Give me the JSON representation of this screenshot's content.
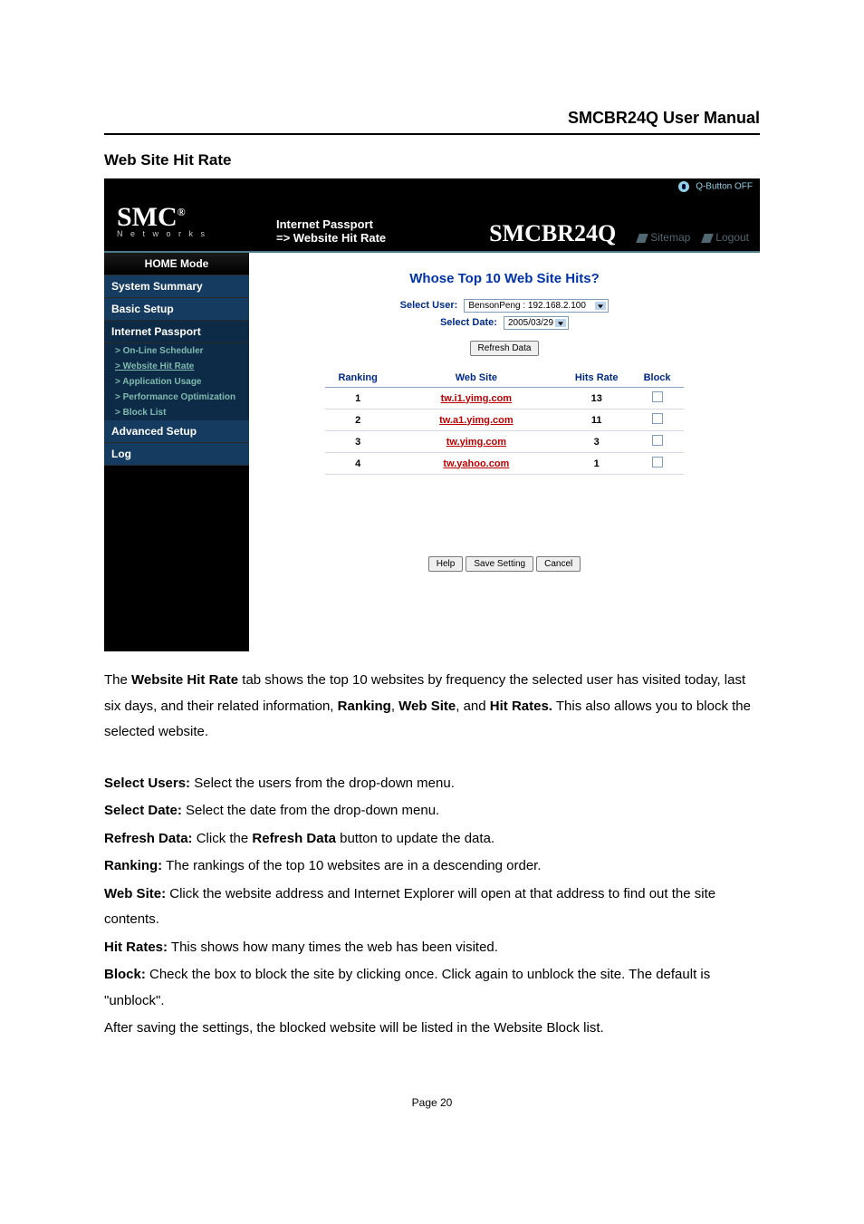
{
  "manual_title": "SMCBR24Q User Manual",
  "section_title": "Web Site Hit Rate",
  "router": {
    "qbutton_label": "Q-Button OFF",
    "logo": {
      "main": "SMC",
      "reg": "®",
      "sub": "N e t w o r k s"
    },
    "breadcrumb": {
      "line1": "Internet Passport",
      "line2": "=> Website Hit Rate"
    },
    "product": "SMCBR24Q",
    "header_links": {
      "sitemap": "Sitemap",
      "logout": "Logout"
    },
    "sidebar": {
      "home": "HOME Mode",
      "summary": "System Summary",
      "basic": "Basic Setup",
      "passport": "Internet Passport",
      "subs": {
        "scheduler": "> On-Line Scheduler",
        "hitrate": "> Website Hit Rate",
        "appusage": "> Application Usage",
        "perf": "> Performance Optimization",
        "block": "> Block List"
      },
      "advanced": "Advanced Setup",
      "log": "Log"
    },
    "content": {
      "title": "Whose Top 10 Web Site Hits?",
      "select_user_label": "Select User:",
      "select_user_value": "BensonPeng : 192.168.2.100",
      "select_date_label": "Select Date:",
      "select_date_value": "2005/03/29",
      "refresh_button": "Refresh Data",
      "table": {
        "headers": {
          "ranking": "Ranking",
          "website": "Web Site",
          "hitsrate": "Hits Rate",
          "block": "Block"
        },
        "rows": [
          {
            "rank": "1",
            "site": "tw.i1.yimg.com",
            "hits": "13"
          },
          {
            "rank": "2",
            "site": "tw.a1.yimg.com",
            "hits": "11"
          },
          {
            "rank": "3",
            "site": "tw.yimg.com",
            "hits": "3"
          },
          {
            "rank": "4",
            "site": "tw.yahoo.com",
            "hits": "1"
          }
        ]
      },
      "actions": {
        "help": "Help",
        "save": "Save Setting",
        "cancel": "Cancel"
      }
    }
  },
  "doc": {
    "p_intro_1": "The ",
    "p_intro_b1": "Website Hit Rate",
    "p_intro_2": " tab shows the top 10 websites by frequency the selected user has visited today, last six days, and their related information, ",
    "p_intro_b2": "Ranking",
    "p_intro_3": ", ",
    "p_intro_b3": "Web Site",
    "p_intro_4": ", and ",
    "p_intro_b4": "Hit Rates.",
    "p_intro_5": " This also allows you to block the selected website.",
    "select_users_b": "Select Users:",
    "select_users_t": " Select the users from the drop-down menu.",
    "select_date_b": "Select Date:",
    "select_date_t": " Select the date from the drop-down menu.",
    "refresh_b1": "Refresh Data:",
    "refresh_t1": " Click the ",
    "refresh_b2": "Refresh Data",
    "refresh_t2": " button to update the data.",
    "ranking_b": "Ranking:",
    "ranking_t": " The rankings of the top 10 websites are in a descending order.",
    "website_b": "Web Site:",
    "website_t": " Click the website address and Internet Explorer will open at that address to find out the site contents.",
    "hitrates_b": "Hit Rates:",
    "hitrates_t": " This shows how many times the web has been visited.",
    "block_b": "Block:",
    "block_t": " Check the box to block the site by clicking once. Click again to unblock the site. The default is \"unblock\".",
    "after_save": "After saving the settings, the blocked website will be listed in the Website Block list."
  },
  "page_number": "Page 20"
}
